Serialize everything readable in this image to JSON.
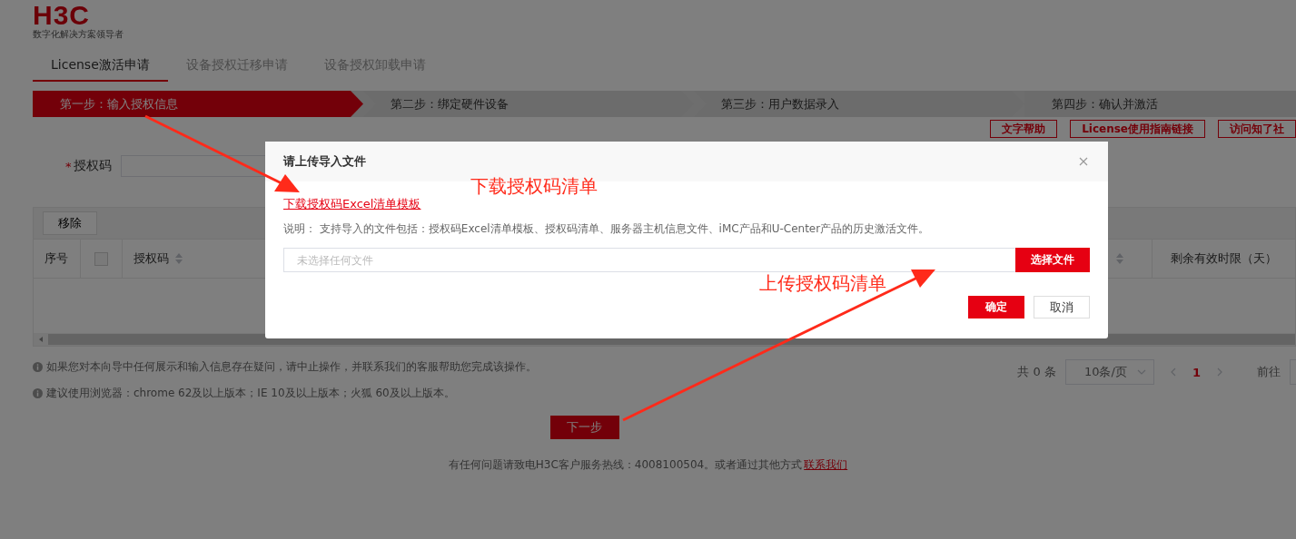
{
  "logo": {
    "wordmark": "H3C",
    "tagline": "数字化解决方案领导者"
  },
  "tabs": [
    {
      "label": "License激活申请",
      "selected": true
    },
    {
      "label": "设备授权迁移申请",
      "selected": false
    },
    {
      "label": "设备授权卸载申请",
      "selected": false
    }
  ],
  "steps": [
    {
      "label": "第一步：输入授权信息",
      "selected": true
    },
    {
      "label": "第二步：绑定硬件设备",
      "selected": false
    },
    {
      "label": "第三步：用户数据录入",
      "selected": false
    },
    {
      "label": "第四步：确认并激活",
      "selected": false
    }
  ],
  "help_links": [
    "文字帮助",
    "License使用指南链接",
    "访问知了社"
  ],
  "form": {
    "required_mark": "*",
    "label": "授权码"
  },
  "table": {
    "toolbar_button": "移除",
    "columns": [
      {
        "kind": "text",
        "label": "序号"
      },
      {
        "kind": "checkbox",
        "checked": false
      },
      {
        "kind": "sortable",
        "label": "授权码"
      },
      {
        "kind": "sort_only"
      },
      {
        "kind": "text",
        "label": "剩余有效时限（天）"
      }
    ]
  },
  "notes": [
    "如果您对本向导中任何展示和输入信息存在疑问，请中止操作，并联系我们的客服帮助您完成该操作。",
    "建议使用浏览器：chrome 62及以上版本；IE 10及以上版本；火狐 60及以上版本。"
  ],
  "pagination": {
    "total": "共 0 条",
    "page_size": "10条/页",
    "current_page": "1",
    "goto_label": "前往"
  },
  "next_button": "下一步",
  "footer": {
    "text": "有任何问题请致电H3C客户服务热线：4008100504。或者通过其他方式",
    "link": "联系我们"
  },
  "dialog": {
    "title": "请上传导入文件",
    "template_link": "下载授权码Excel清单模板",
    "description": "说明： 支持导入的文件包括：授权码Excel清单模板、授权码清单、服务器主机信息文件、iMC产品和U-Center产品的历史激活文件。",
    "file_placeholder": "未选择任何文件",
    "choose_button": "选择文件",
    "confirm_button": "确定",
    "cancel_button": "取消"
  },
  "annotations": [
    {
      "text": "下载授权码清单"
    },
    {
      "text": "上传授权码清单"
    }
  ]
}
